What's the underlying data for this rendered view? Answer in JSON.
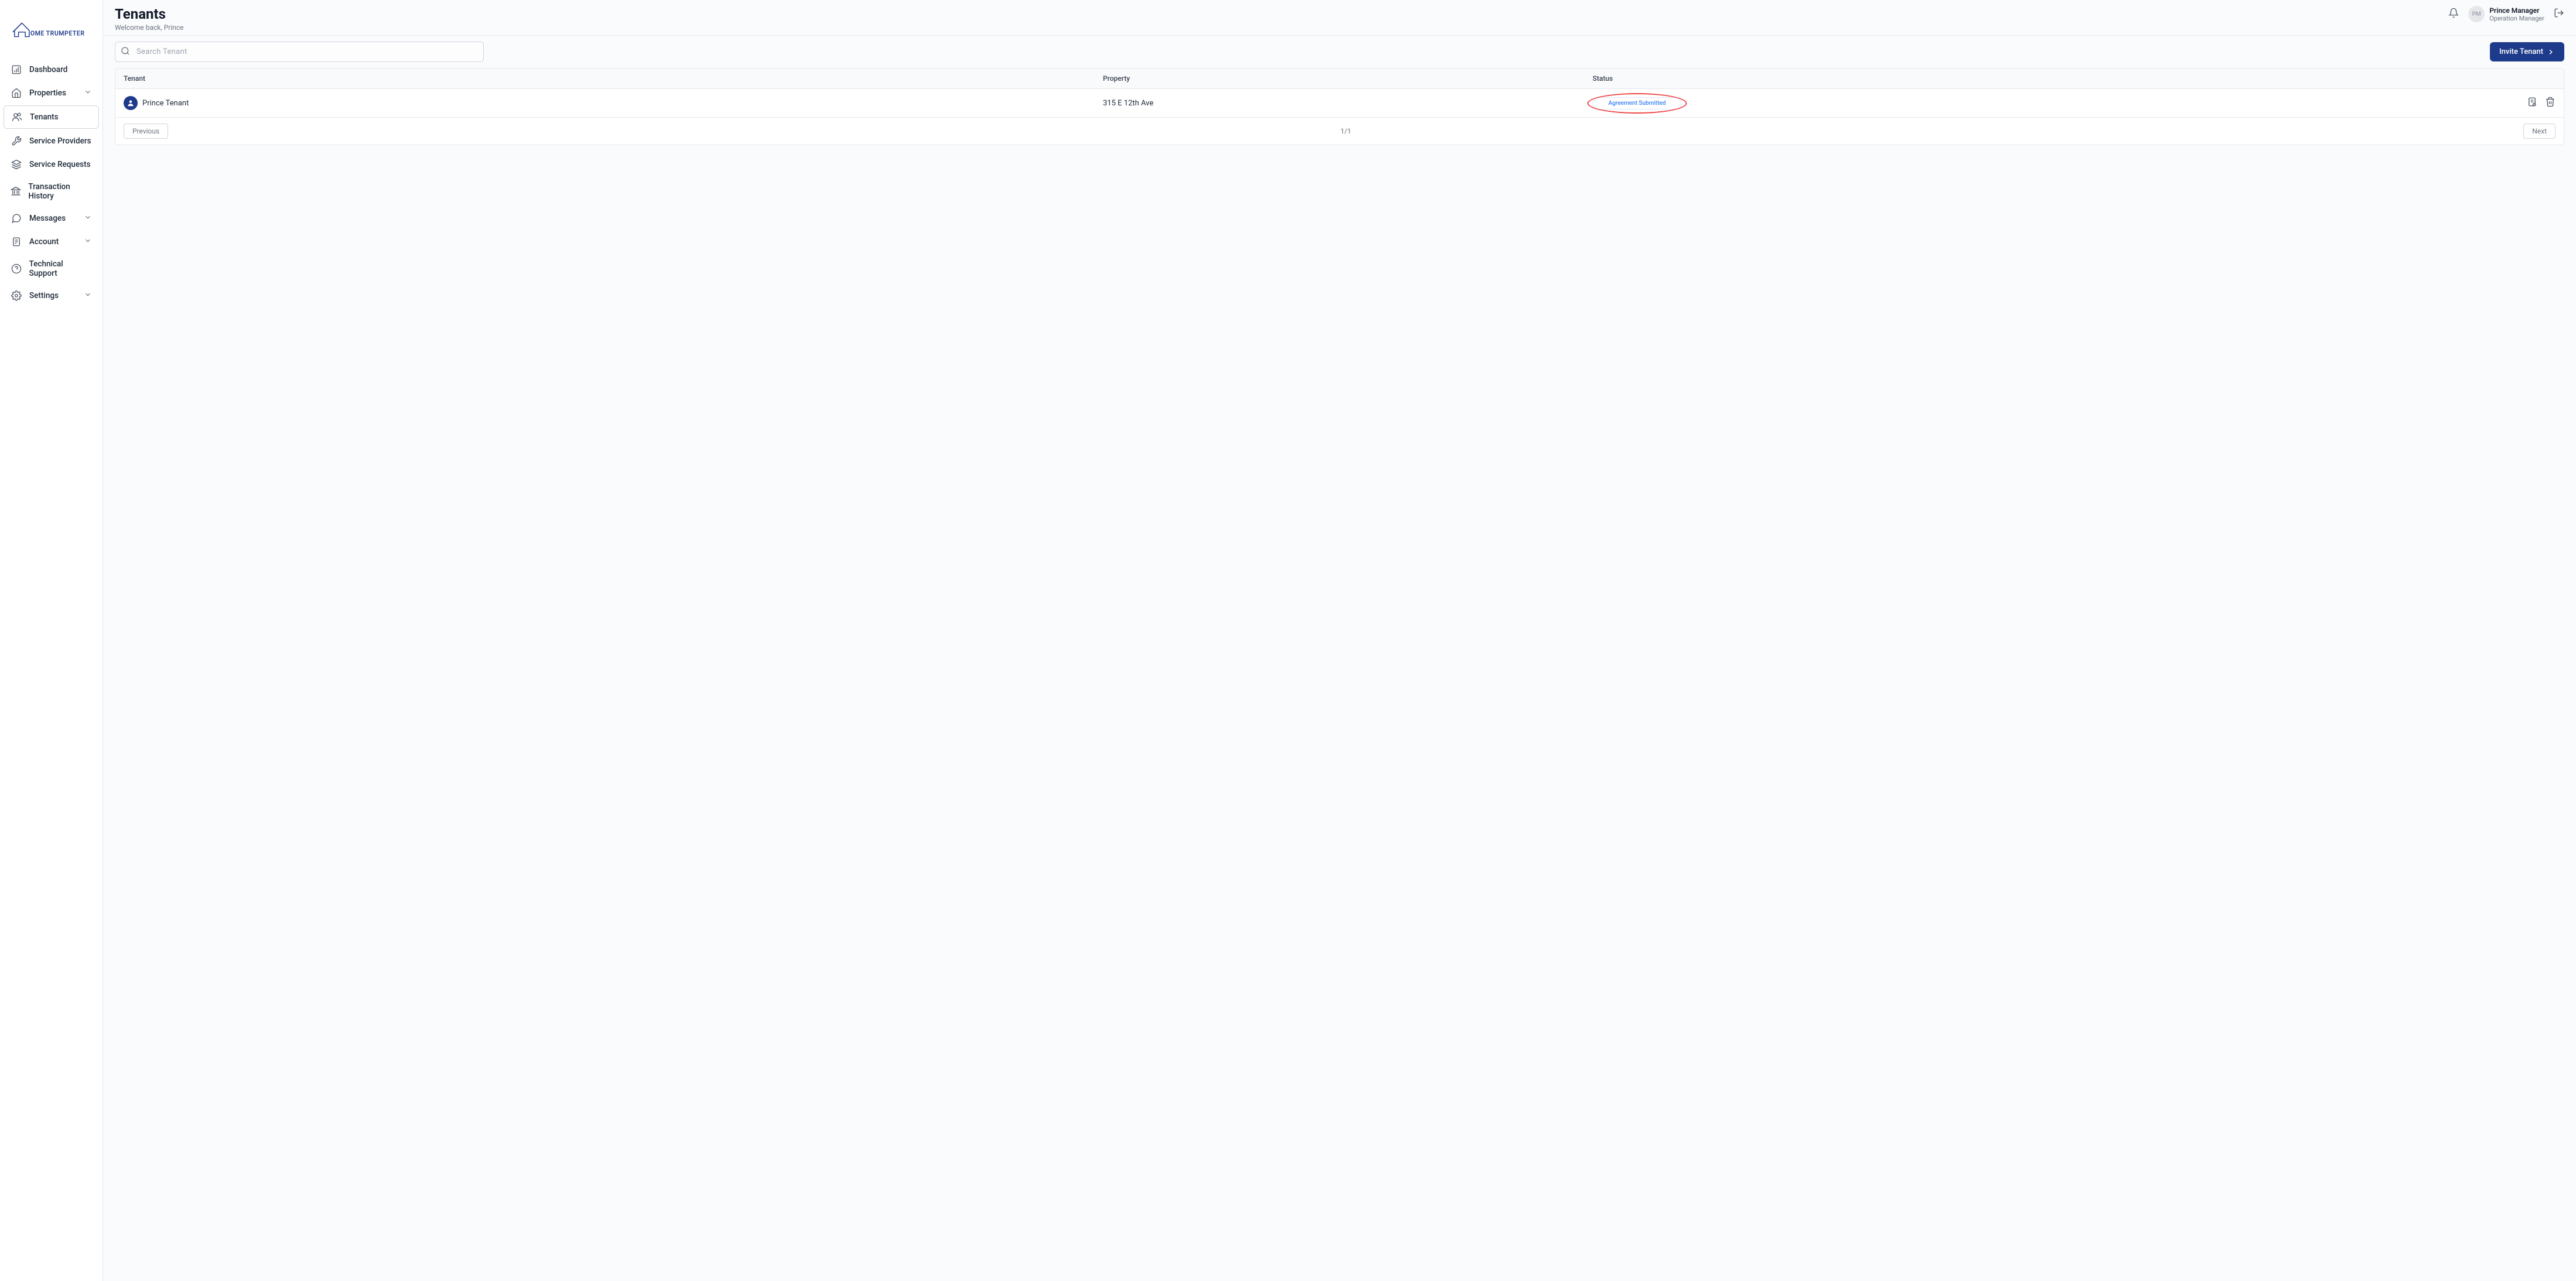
{
  "brand": {
    "name": "OME TRUMPETER"
  },
  "sidebar": {
    "items": [
      {
        "label": "Dashboard",
        "icon": "dashboard",
        "active": false,
        "hasChevron": false
      },
      {
        "label": "Properties",
        "icon": "home",
        "active": false,
        "hasChevron": true
      },
      {
        "label": "Tenants",
        "icon": "users",
        "active": true,
        "hasChevron": false
      },
      {
        "label": "Service Providers",
        "icon": "tools",
        "active": false,
        "hasChevron": false
      },
      {
        "label": "Service Requests",
        "icon": "layers",
        "active": false,
        "hasChevron": false
      },
      {
        "label": "Transaction History",
        "icon": "bank",
        "active": false,
        "hasChevron": false
      },
      {
        "label": "Messages",
        "icon": "chat",
        "active": false,
        "hasChevron": true
      },
      {
        "label": "Account",
        "icon": "document",
        "active": false,
        "hasChevron": true
      },
      {
        "label": "Technical Support",
        "icon": "help",
        "active": false,
        "hasChevron": false
      },
      {
        "label": "Settings",
        "icon": "gear",
        "active": false,
        "hasChevron": true
      }
    ]
  },
  "header": {
    "title": "Tenants",
    "subtitle": "Welcome back, Prince",
    "user": {
      "initials": "PM",
      "name": "Prince Manager",
      "role": "Operation Manager"
    }
  },
  "toolbar": {
    "search_placeholder": "Search Tenant",
    "invite_label": "Invite Tenant"
  },
  "table": {
    "headers": {
      "tenant": "Tenant",
      "property": "Property",
      "status": "Status"
    },
    "rows": [
      {
        "tenant_name": "Prince Tenant",
        "property": "315 E 12th Ave",
        "status": "Agreement Submitted"
      }
    ]
  },
  "pagination": {
    "prev": "Previous",
    "indicator": "1/1",
    "next": "Next"
  }
}
